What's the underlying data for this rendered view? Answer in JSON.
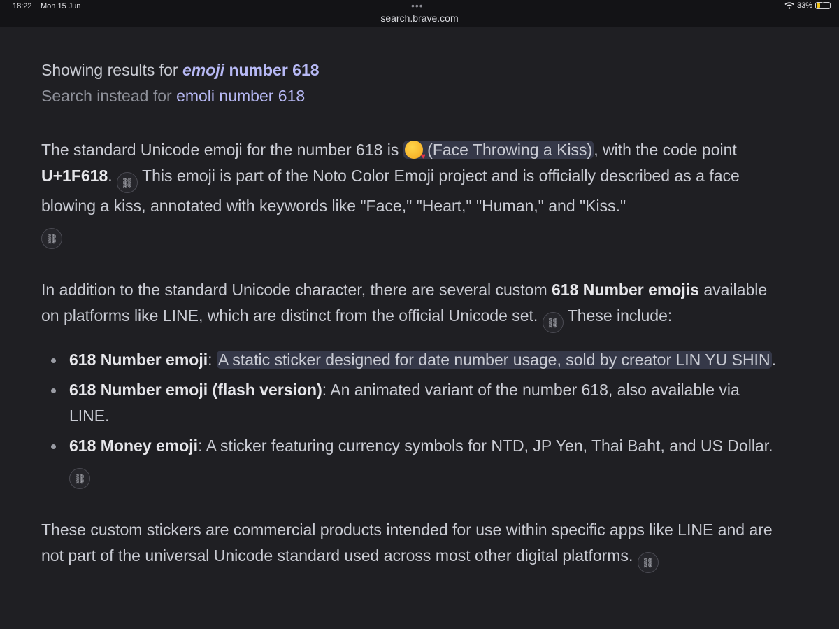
{
  "status": {
    "time": "18:22",
    "date": "Mon 15 Jun",
    "battery": "33%",
    "battery_level": 0.33
  },
  "browser": {
    "url": "search.brave.com",
    "menu": "•••"
  },
  "spell": {
    "prefix": "Showing results for",
    "query_italic": "emoji",
    "query_rest": "number 618",
    "alt_prefix": "Search instead for",
    "alt_query": "emoli number 618"
  },
  "answer": {
    "p1_a": "The standard Unicode emoji for the number 618 is ",
    "p1_emoji": "😘",
    "p1_hl": " (Face Throwing a Kiss)",
    "p1_b": ", with the code point ",
    "p1_code": "U+1F618",
    "p1_c": ". ",
    "p1_d": " This emoji is part of the Noto Color Emoji project and is officially described as a face blowing a kiss, annotated with keywords like \"Face,\" \"Heart,\" \"Human,\" and \"Kiss.\"",
    "p2_a": "In addition to the standard Unicode character, there are several custom ",
    "p2_bold": "618 Number emojis",
    "p2_b": " available on platforms like LINE, which are distinct from the official Unicode set. ",
    "p2_c": " These include:",
    "items": [
      {
        "bold": "618 Number emoji",
        "sep": ": ",
        "hl": "A static sticker designed for date number usage, sold by creator LIN YU SHIN",
        "rest": "."
      },
      {
        "bold": "618 Number emoji (flash version)",
        "sep": ": ",
        "rest": "An animated variant of the number 618, also available via LINE."
      },
      {
        "bold": "618 Money emoji",
        "sep": ": ",
        "rest": "A sticker featuring currency symbols for NTD, JP Yen, Thai Baht, and US Dollar."
      }
    ],
    "p3": "These custom stickers are commercial products intended for use within specific apps like LINE and are not part of the universal Unicode standard used across most other digital platforms."
  },
  "icons": {
    "citation": "link-icon",
    "emoji": "face-throwing-kiss-emoji"
  }
}
